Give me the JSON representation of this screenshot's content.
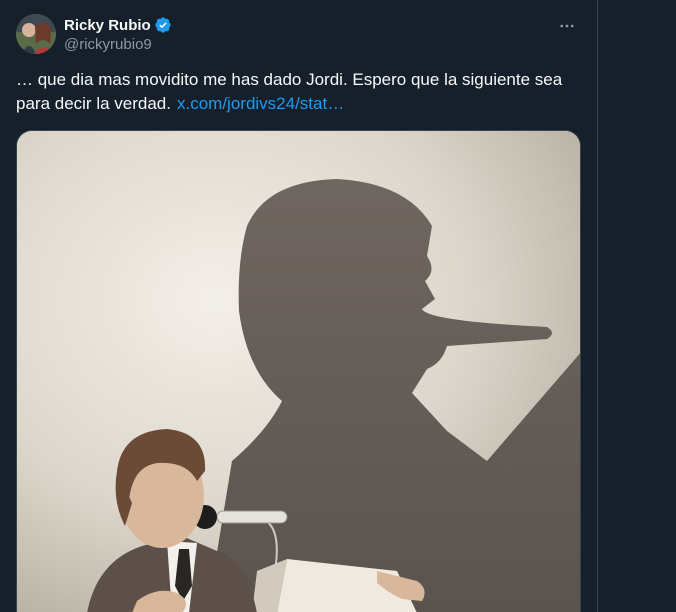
{
  "tweet": {
    "author_name": "Ricky Rubio",
    "author_handle": "@rickyrubio9",
    "text": "… que dia mas movidito me has dado Jordi. Espero que la siguiente sea para decir la verdad.",
    "link": "x.com/jordivs24/stat…",
    "more_icon": "more-horizontal-icon",
    "verified_icon": "verified-badge-icon"
  },
  "colors": {
    "background": "#15202b",
    "text": "#f7f9f9",
    "secondary_text": "#8b98a5",
    "link": "#1d9bf0",
    "verified": "#1d9bf0",
    "border": "#38444d"
  },
  "media": {
    "description_icon": "illustration-image"
  }
}
